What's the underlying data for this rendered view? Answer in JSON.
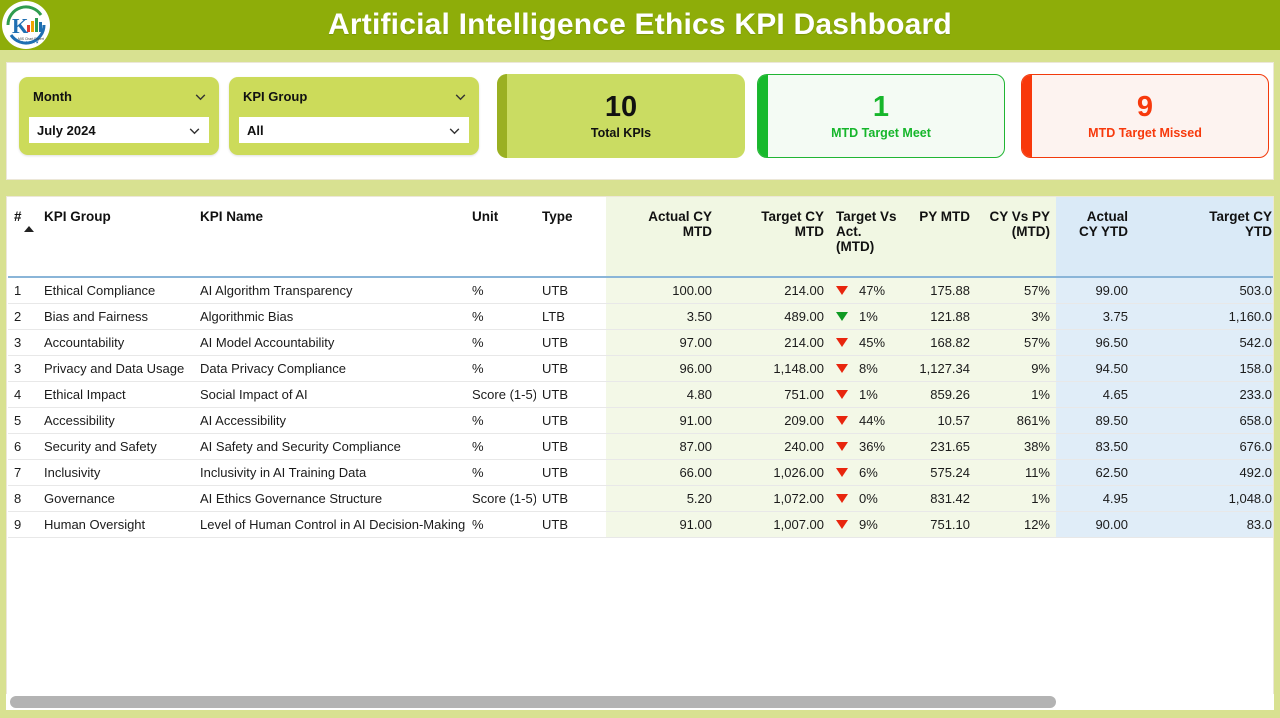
{
  "header": {
    "title": "Artificial Intelligence Ethics KPI Dashboard",
    "logo_alt": "company-logo",
    "bar_color": "#8ead09"
  },
  "filters": [
    {
      "name": "month",
      "label": "Month",
      "value": "July 2024",
      "caret_icon": "chevron-down-icon"
    },
    {
      "name": "kpi_group",
      "label": "KPI Group",
      "value": "All",
      "caret_icon": "chevron-down-icon"
    }
  ],
  "kpi_cards": [
    {
      "name": "total-kpis",
      "value": "10",
      "label": "Total KPIs",
      "accent": "#9ab022",
      "bg": "#cadc62",
      "text": "#111111"
    },
    {
      "name": "mtd-target-meet",
      "value": "1",
      "label": "MTD Target Meet",
      "accent": "#17b92c",
      "bg": "#f4fbf4",
      "text": "#16b62b"
    },
    {
      "name": "mtd-target-missed",
      "value": "9",
      "label": "MTD Target Missed",
      "accent": "#f8380b",
      "bg": "#fdf3f0",
      "text": "#f7390c"
    }
  ],
  "table": {
    "columns": [
      {
        "key": "idx",
        "label": "#",
        "align": "left",
        "group": "none",
        "sorted": true
      },
      {
        "key": "kpi_group",
        "label": "KPI Group",
        "align": "left",
        "group": "none"
      },
      {
        "key": "kpi_name",
        "label": "KPI Name",
        "align": "left",
        "group": "none"
      },
      {
        "key": "unit",
        "label": "Unit",
        "align": "left",
        "group": "none"
      },
      {
        "key": "type",
        "label": "Type",
        "align": "left",
        "group": "none"
      },
      {
        "key": "actual_mtd",
        "label": "Actual CY MTD",
        "align": "right",
        "group": "mtd"
      },
      {
        "key": "target_mtd",
        "label": "Target CY MTD",
        "align": "right",
        "group": "mtd"
      },
      {
        "key": "tgt_vs_act",
        "label": "Target Vs Act. (MTD)",
        "align": "left",
        "group": "mtd"
      },
      {
        "key": "py_mtd",
        "label": "PY MTD",
        "align": "right",
        "group": "mtd"
      },
      {
        "key": "cy_vs_py",
        "label": "CY Vs PY (MTD)",
        "align": "right",
        "group": "mtd"
      },
      {
        "key": "actual_ytd",
        "label": "Actual CY YTD",
        "align": "right",
        "group": "ytd"
      },
      {
        "key": "target_ytd",
        "label": "Target CY YTD",
        "align": "right",
        "group": "ytd"
      }
    ],
    "sort_indicator": "sort-ascending-icon",
    "rows": [
      {
        "idx": "1",
        "kpi_group": "Ethical Compliance",
        "kpi_name": "AI Algorithm Transparency",
        "unit": "%",
        "type": "UTB",
        "actual_mtd": "100.00",
        "target_mtd": "214.00",
        "tgt_vs_act": "47%",
        "tgt_vs_act_dir": "down",
        "tgt_vs_act_color": "red",
        "py_mtd": "175.88",
        "cy_vs_py": "57%",
        "actual_ytd": "99.00",
        "target_ytd": "503.0"
      },
      {
        "idx": "2",
        "kpi_group": "Bias and Fairness",
        "kpi_name": "Algorithmic Bias",
        "unit": "%",
        "type": "LTB",
        "actual_mtd": "3.50",
        "target_mtd": "489.00",
        "tgt_vs_act": "1%",
        "tgt_vs_act_dir": "down",
        "tgt_vs_act_color": "green",
        "py_mtd": "121.88",
        "cy_vs_py": "3%",
        "actual_ytd": "3.75",
        "target_ytd": "1,160.0"
      },
      {
        "idx": "3",
        "kpi_group": "Accountability",
        "kpi_name": "AI Model Accountability",
        "unit": "%",
        "type": "UTB",
        "actual_mtd": "97.00",
        "target_mtd": "214.00",
        "tgt_vs_act": "45%",
        "tgt_vs_act_dir": "down",
        "tgt_vs_act_color": "red",
        "py_mtd": "168.82",
        "cy_vs_py": "57%",
        "actual_ytd": "96.50",
        "target_ytd": "542.0"
      },
      {
        "idx": "3",
        "kpi_group": "Privacy and Data Usage",
        "kpi_name": "Data Privacy Compliance",
        "unit": "%",
        "type": "UTB",
        "actual_mtd": "96.00",
        "target_mtd": "1,148.00",
        "tgt_vs_act": "8%",
        "tgt_vs_act_dir": "down",
        "tgt_vs_act_color": "red",
        "py_mtd": "1,127.34",
        "cy_vs_py": "9%",
        "actual_ytd": "94.50",
        "target_ytd": "158.0"
      },
      {
        "idx": "4",
        "kpi_group": "Ethical Impact",
        "kpi_name": "Social Impact of AI",
        "unit": "Score (1-5)",
        "type": "UTB",
        "actual_mtd": "4.80",
        "target_mtd": "751.00",
        "tgt_vs_act": "1%",
        "tgt_vs_act_dir": "down",
        "tgt_vs_act_color": "red",
        "py_mtd": "859.26",
        "cy_vs_py": "1%",
        "actual_ytd": "4.65",
        "target_ytd": "233.0"
      },
      {
        "idx": "5",
        "kpi_group": "Accessibility",
        "kpi_name": "AI Accessibility",
        "unit": "%",
        "type": "UTB",
        "actual_mtd": "91.00",
        "target_mtd": "209.00",
        "tgt_vs_act": "44%",
        "tgt_vs_act_dir": "down",
        "tgt_vs_act_color": "red",
        "py_mtd": "10.57",
        "cy_vs_py": "861%",
        "actual_ytd": "89.50",
        "target_ytd": "658.0"
      },
      {
        "idx": "6",
        "kpi_group": "Security and Safety",
        "kpi_name": "AI Safety and Security Compliance",
        "unit": "%",
        "type": "UTB",
        "actual_mtd": "87.00",
        "target_mtd": "240.00",
        "tgt_vs_act": "36%",
        "tgt_vs_act_dir": "down",
        "tgt_vs_act_color": "red",
        "py_mtd": "231.65",
        "cy_vs_py": "38%",
        "actual_ytd": "83.50",
        "target_ytd": "676.0"
      },
      {
        "idx": "7",
        "kpi_group": "Inclusivity",
        "kpi_name": "Inclusivity in AI Training Data",
        "unit": "%",
        "type": "UTB",
        "actual_mtd": "66.00",
        "target_mtd": "1,026.00",
        "tgt_vs_act": "6%",
        "tgt_vs_act_dir": "down",
        "tgt_vs_act_color": "red",
        "py_mtd": "575.24",
        "cy_vs_py": "11%",
        "actual_ytd": "62.50",
        "target_ytd": "492.0"
      },
      {
        "idx": "8",
        "kpi_group": "Governance",
        "kpi_name": "AI Ethics Governance Structure",
        "unit": "Score (1-5)",
        "type": "UTB",
        "actual_mtd": "5.20",
        "target_mtd": "1,072.00",
        "tgt_vs_act": "0%",
        "tgt_vs_act_dir": "down",
        "tgt_vs_act_color": "red",
        "py_mtd": "831.42",
        "cy_vs_py": "1%",
        "actual_ytd": "4.95",
        "target_ytd": "1,048.0"
      },
      {
        "idx": "9",
        "kpi_group": "Human Oversight",
        "kpi_name": "Level of Human Control in AI Decision-Making",
        "unit": "%",
        "type": "UTB",
        "actual_mtd": "91.00",
        "target_mtd": "1,007.00",
        "tgt_vs_act": "9%",
        "tgt_vs_act_dir": "down",
        "tgt_vs_act_color": "red",
        "py_mtd": "751.10",
        "cy_vs_py": "12%",
        "actual_ytd": "90.00",
        "target_ytd": "83.0"
      }
    ]
  },
  "scrollbar": {
    "name": "horizontal-scrollbar",
    "thumb_fraction": 0.83
  }
}
